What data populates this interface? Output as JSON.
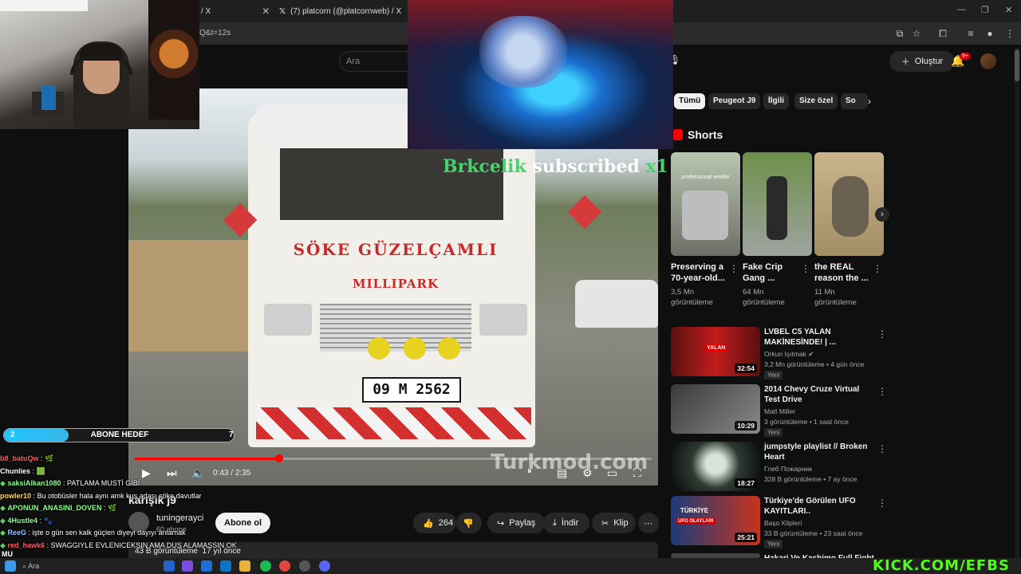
{
  "browser": {
    "tabs": [
      {
        "title": "/ X"
      },
      {
        "title": "(7) platcorn (@platcornweb) / X"
      }
    ],
    "url": "Q&t=12s"
  },
  "youtube": {
    "search_placeholder": "Ara",
    "create_label": "Oluştur",
    "notifications_badge": "9+"
  },
  "video": {
    "overlay_name": "Brkcelik",
    "overlay_text": "subscribed",
    "overlay_mult": "x1",
    "overlay_excl": "!",
    "truck_line1": "SÖKE GÜZELÇAMLI",
    "truck_line2": "MILLIPARK",
    "plate": "09 M 2562",
    "watermark": "Turkmod.com",
    "time_current": "0:43",
    "time_total": "2:35",
    "time_separator": "/",
    "progress": 0.28,
    "title": "karışık j9",
    "channel": "tuningerayci",
    "channel_subs": "60 abone",
    "subscribe_label": "Abone ol",
    "likes": "264",
    "share_label": "Paylaş",
    "download_label": "İndir",
    "clip_label": "Klip",
    "views": "43 B görüntüleme",
    "age": "17 yıl önce"
  },
  "stream": {
    "goal_label": "ABONE HEDEF",
    "goal_current": "2",
    "goal_target": "7",
    "goal_fraction": 0.28,
    "chat": [
      {
        "user": "b8_batuQw",
        "sep": ":",
        "msg": "",
        "color": "#ff5a5a"
      },
      {
        "user": "Chunlies",
        "sep": ":",
        "msg": "",
        "color": "#ffffff"
      },
      {
        "user": "saksiAlkan1080",
        "sep": ":",
        "msg": "PATLAMA MUSTİ GİBİ",
        "color": "#8cff8c"
      },
      {
        "user": "powler10",
        "sep": ":",
        "msg": "Bu otobüsler hala aynı amk kuş adası söke davutlar",
        "color": "#ffd85a"
      },
      {
        "user": "APONUN_ANASINI_DOVEN",
        "sep": ":",
        "msg": "",
        "color": "#8cff8c"
      },
      {
        "user": "4Hustle4",
        "sep": ":",
        "msg": "",
        "color": "#8cff8c"
      },
      {
        "user": "ReeG",
        "sep": ":",
        "msg": "işte o gün sen kalk güçlen diyeyi dayıyı anlamak",
        "color": "#8cc8ff"
      },
      {
        "user": "red_hawk6",
        "sep": ":",
        "msg": "SWAGGIYLE EVLENICEKSIN AMA DUŞ ALAMASSIN OK",
        "color": "#ff5a5a"
      }
    ],
    "footer_line": "MU",
    "kick_brand": "KICK.COM/EFBS"
  },
  "sidebar": {
    "chips": [
      "Tümü",
      "Peugeot J9",
      "İlgili",
      "Size özel",
      "So"
    ],
    "shorts_label": "Shorts",
    "shorts": [
      {
        "title": "Preserving a 70-year-old...",
        "views": "3,5 Mn görüntüleme",
        "thumb_text": "professional welder"
      },
      {
        "title": "Fake Crip Gang ...",
        "views": "64 Mn görüntüleme"
      },
      {
        "title": "the REAL reason the ...",
        "views": "11 Mn görüntüleme"
      }
    ],
    "videos": [
      {
        "title": "LVBEL C5 YALAN MAKİNESİNDE! | ...",
        "channel": "Orkun Işıtmak",
        "meta": "3,2 Mn görüntüleme • 4 gün önce",
        "badge": "Yeni",
        "duration": "32:54",
        "thumb_text": "YALAN",
        "verified": true
      },
      {
        "title": "2014 Chevy Cruze Virtual Test Drive",
        "channel": "Matt Miller",
        "meta": "3 görüntüleme • 1 saat önce",
        "badge": "Yeni",
        "duration": "10:29"
      },
      {
        "title": "jumpstyle playlist // Broken Heart",
        "channel": "Глеб Пожарник",
        "meta": "328 B görüntüleme • 7 ay önce",
        "duration": "18:27"
      },
      {
        "title": "Türkiye'de Görülen UFO KAYITLARI..",
        "channel": "Başo Klipleri",
        "meta": "33 B görüntüleme • 23 saat önce",
        "badge": "Yeni",
        "duration": "25:21",
        "thumb_text": "UFO OLAYLARI",
        "thumb_title": "TÜRKİYE"
      },
      {
        "title": "Hakari Ve Kashimo Full Fight",
        "channel": "",
        "meta": ""
      }
    ]
  },
  "taskbar": {
    "search_text": "Ara"
  },
  "colors": {
    "accent": "#ff0000",
    "kick_green": "#53fc18",
    "background": "#0f0f0f"
  }
}
